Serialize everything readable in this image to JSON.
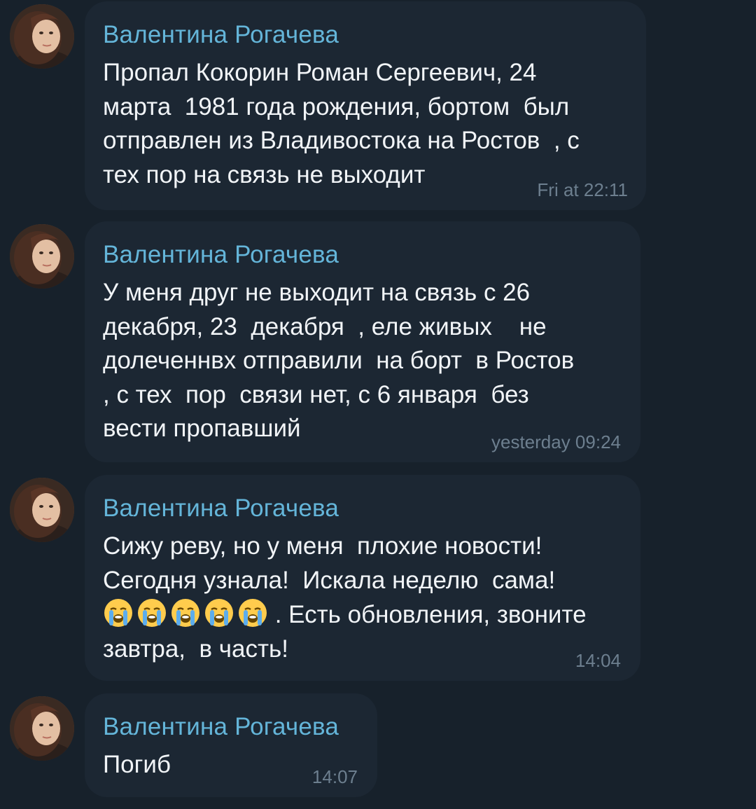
{
  "messages": [
    {
      "sender": "Валентина Рогачева",
      "lines": [
        "Пропал Кокорин Роман Сергеевич, 24",
        "марта  1981 года рождения, бортом  был",
        "отправлен из Владивостока на Ростов  , с",
        "тех пор на связь не выходит"
      ],
      "time": "Fri at 22:11"
    },
    {
      "sender": "Валентина Рогачева",
      "lines": [
        "У меня друг не выходит на связь с 26",
        "декабря, 23  декабря  , еле живых    не",
        "долеченнвх отправили  на борт  в Ростов",
        ", с тех  пор  связи нет, с 6 января  без",
        "вести пропавший"
      ],
      "time": "yesterday 09:24"
    },
    {
      "sender": "Валентина Рогачева",
      "lines": [
        "Сижу реву, но у меня  плохие новости!",
        "Сегодня узнала!  Искала неделю  сама!",
        " . Есть обновления, звоните",
        "завтра,  в часть!"
      ],
      "emoji": "loudly-crying-face",
      "emoji_count": 5,
      "time": "14:04"
    },
    {
      "sender": "Валентина Рогачева",
      "lines": [
        "Погиб"
      ],
      "time": "14:07"
    }
  ],
  "colors": {
    "background": "#17212b",
    "bubble": "#1c2733",
    "sender": "#64b5d9",
    "text": "#f1f4f7",
    "time": "#6d7f8f"
  }
}
